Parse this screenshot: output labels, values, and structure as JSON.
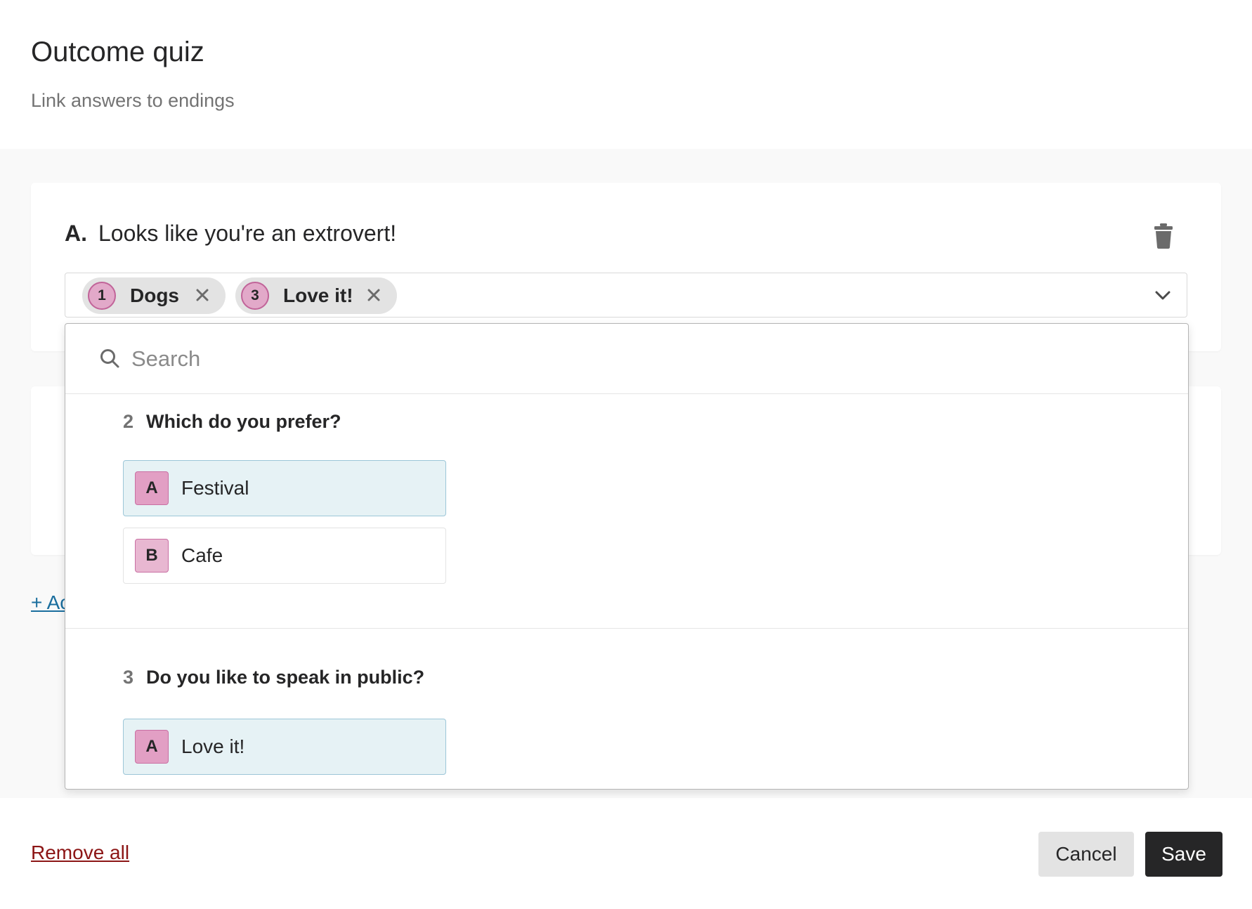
{
  "header": {
    "title": "Outcome quiz",
    "subtitle": "Link answers to endings"
  },
  "endings": [
    {
      "letter": "A.",
      "title": "Looks like you're an extrovert!",
      "selected_chips": [
        {
          "number": "1",
          "label": "Dogs"
        },
        {
          "number": "3",
          "label": "Love it!"
        }
      ]
    }
  ],
  "add_link": "+ Ac",
  "dropdown": {
    "search_placeholder": "Search",
    "groups": [
      {
        "number": "2",
        "question": "Which do you prefer?",
        "options": [
          {
            "letter": "A",
            "label": "Festival",
            "selected": true
          },
          {
            "letter": "B",
            "label": "Cafe",
            "selected": false
          }
        ]
      },
      {
        "number": "3",
        "question": "Do you like to speak in public?",
        "options": [
          {
            "letter": "A",
            "label": "Love it!",
            "selected": true
          }
        ]
      }
    ]
  },
  "footer": {
    "remove_all": "Remove all",
    "cancel": "Cancel",
    "save": "Save"
  },
  "colors": {
    "pink_badge": "#e2a9c9",
    "pink_border": "#c16499",
    "selected_bg": "#e6f2f5",
    "danger_link": "#8c1515",
    "primary_button": "#262627",
    "link": "#1a6e9e"
  }
}
